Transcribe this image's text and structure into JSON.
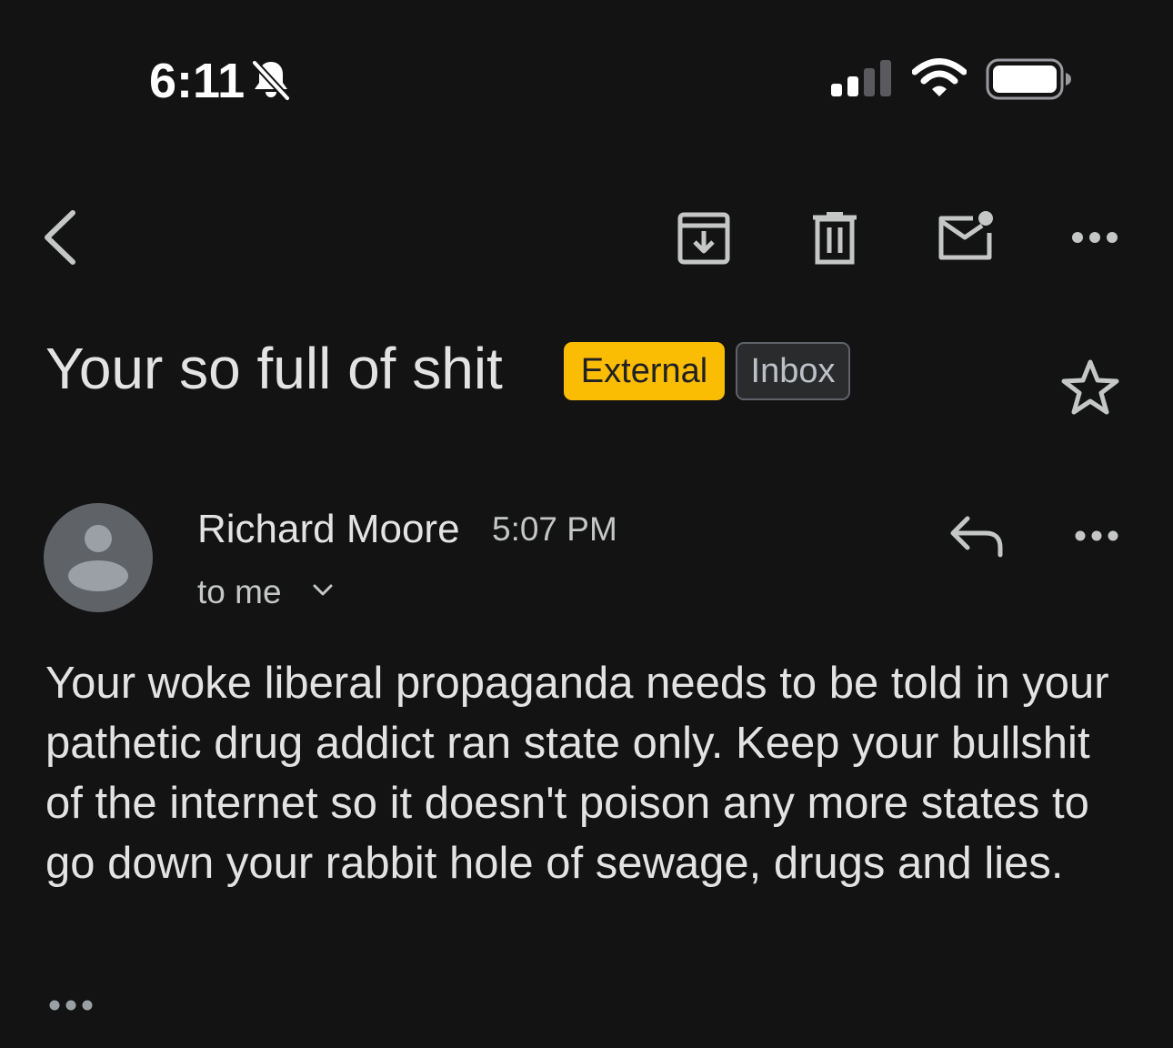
{
  "status_bar": {
    "time": "6:11",
    "icons": [
      "bell-slash-icon",
      "signal-icon",
      "wifi-icon",
      "battery-icon"
    ]
  },
  "toolbar": {
    "icons": [
      "back-icon",
      "archive-icon",
      "delete-icon",
      "mark-unread-icon",
      "more-icon"
    ]
  },
  "email": {
    "subject": "Your so full of shit",
    "labels": {
      "external": "External",
      "inbox": "Inbox"
    },
    "sender": "Richard Moore",
    "time": "5:07 PM",
    "recipients": "to me",
    "body": "Your woke liberal propaganda needs to be told in your pathetic drug addict ran state only. Keep your bullshit of the internet so it doesn't poison any more states to go down your rabbit hole of sewage, drugs and lies."
  },
  "colors": {
    "background": "#131314",
    "external_label": "#fbbc04",
    "text": "#e3e3e3"
  }
}
